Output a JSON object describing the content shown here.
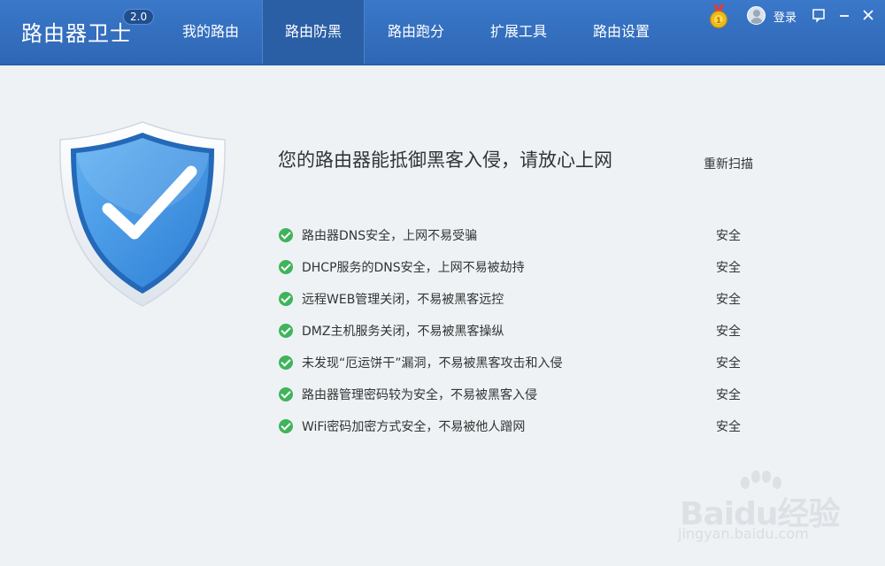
{
  "header": {
    "app_title": "路由器卫士",
    "version": "2.0",
    "nav": [
      {
        "label": "我的路由"
      },
      {
        "label": "路由防黑",
        "active": true
      },
      {
        "label": "路由跑分"
      },
      {
        "label": "扩展工具"
      },
      {
        "label": "路由设置"
      }
    ],
    "login_label": "登录",
    "icons": [
      "medal-icon",
      "avatar-icon",
      "menu-icon",
      "minimize-icon",
      "close-icon"
    ]
  },
  "main": {
    "headline": "您的路由器能抵御黑客入侵，请放心上网",
    "rescan_label": "重新扫描",
    "checks": [
      {
        "text": "路由器DNS安全，上网不易受骗",
        "status": "安全"
      },
      {
        "text": "DHCP服务的DNS安全，上网不易被劫持",
        "status": "安全"
      },
      {
        "text": "远程WEB管理关闭，不易被黑客远控",
        "status": "安全"
      },
      {
        "text": "DMZ主机服务关闭，不易被黑客操纵",
        "status": "安全"
      },
      {
        "text": "未发现“厄运饼干”漏洞，不易被黑客攻击和入侵",
        "status": "安全"
      },
      {
        "text": "路由器管理密码较为安全，不易被黑客入侵",
        "status": "安全"
      },
      {
        "text": "WiFi密码加密方式安全，不易被他人蹭网",
        "status": "安全"
      }
    ]
  },
  "watermark": {
    "brand": "Baidu经验",
    "url": "jingyan.baidu.com"
  },
  "colors": {
    "header_bg": "#3a78c9",
    "nav_active": "#2a5ea5",
    "check_green": "#3fb45a",
    "shield_blue": "#3d8fe3"
  }
}
